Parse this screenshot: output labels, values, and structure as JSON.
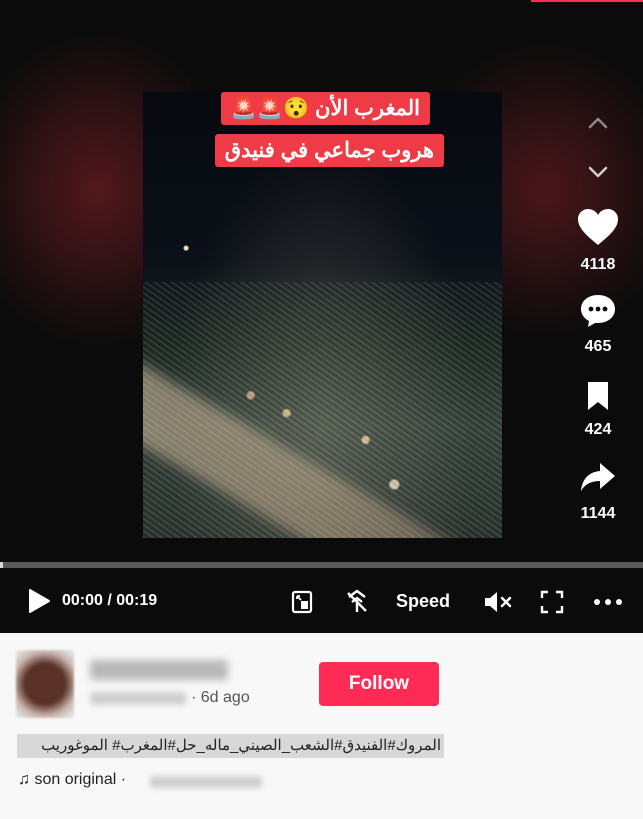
{
  "video": {
    "caption_line1": "المغرب الأن 😯🚨🚨",
    "caption_line2": "هروب جماعي في فنيدق",
    "current_time": "00:00",
    "duration": "00:19",
    "time_display": "00:00 / 00:19",
    "progress_fraction": 0.0,
    "speed_label": "Speed"
  },
  "actions": {
    "likes": "4118",
    "comments": "465",
    "saves": "424",
    "shares": "1144"
  },
  "author": {
    "post_age": "· 6d ago",
    "follow_label": "Follow"
  },
  "description": "المروك#الفنيدق#الشعب_الصيني_ماله_حل#المغرب# الموغوريب",
  "music": {
    "label": "son original ·"
  },
  "colors": {
    "accent": "#fe2c55",
    "caption_bg": "#ee3b46"
  }
}
